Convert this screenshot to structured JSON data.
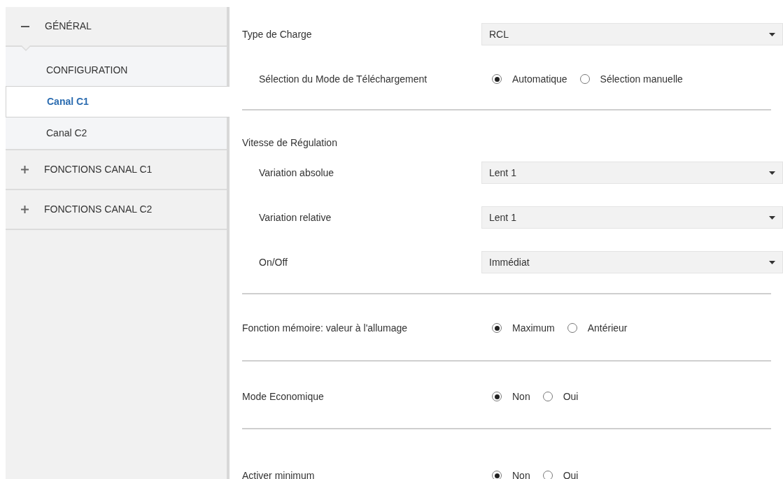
{
  "sidebar": {
    "groups": [
      {
        "label": "GÉNÉRAL",
        "expanded": true,
        "children": [
          {
            "label": "CONFIGURATION",
            "selected": false
          },
          {
            "label": "Canal C1",
            "selected": true
          },
          {
            "label": "Canal C2",
            "selected": false
          }
        ]
      },
      {
        "label": "FONCTIONS CANAL C1",
        "expanded": false
      },
      {
        "label": "FONCTIONS CANAL C2",
        "expanded": false
      }
    ]
  },
  "sections": [
    {
      "rows": [
        {
          "kind": "select",
          "label": "Type de Charge",
          "value": "RCL",
          "children": [
            {
              "kind": "radio",
              "label": "Sélection du Mode de Téléchargement",
              "options": [
                {
                  "label": "Automatique",
                  "selected": true
                },
                {
                  "label": "Sélection manuelle",
                  "selected": false
                }
              ]
            }
          ]
        }
      ]
    },
    {
      "rows": [
        {
          "kind": "heading",
          "label": "Vitesse de Régulation",
          "children": [
            {
              "kind": "select",
              "label": "Variation absolue",
              "value": "Lent 1"
            },
            {
              "kind": "select",
              "label": "Variation relative",
              "value": "Lent 1"
            },
            {
              "kind": "select",
              "label": "On/Off",
              "value": "Immédiat"
            }
          ]
        }
      ]
    },
    {
      "rows": [
        {
          "kind": "radio",
          "label": "Fonction mémoire: valeur à l'allumage",
          "options": [
            {
              "label": "Maximum",
              "selected": true
            },
            {
              "label": "Antérieur",
              "selected": false
            }
          ]
        }
      ]
    },
    {
      "rows": [
        {
          "kind": "radio",
          "label": "Mode Economique",
          "options": [
            {
              "label": "Non",
              "selected": true
            },
            {
              "label": "Oui",
              "selected": false
            }
          ]
        }
      ]
    },
    {
      "rows": [
        {
          "kind": "radio",
          "label": "Activer minimum",
          "options": [
            {
              "label": "Non",
              "selected": true
            },
            {
              "label": "Oui",
              "selected": false
            }
          ]
        }
      ]
    }
  ]
}
